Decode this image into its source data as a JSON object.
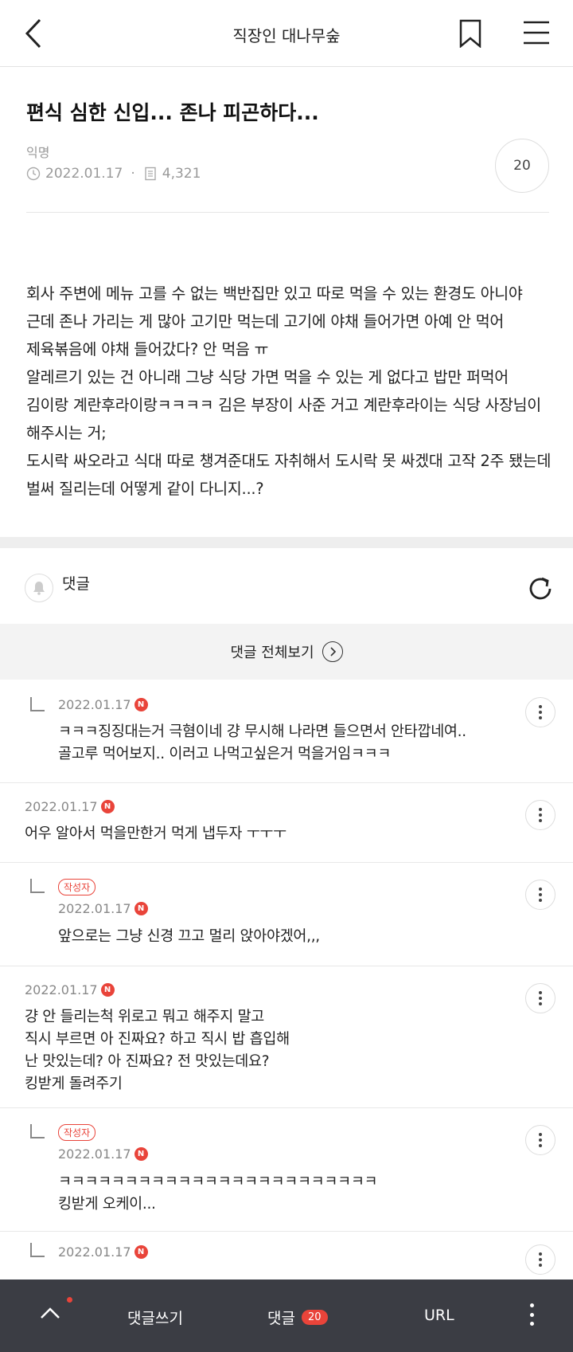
{
  "header": {
    "title": "직장인 대나무숲",
    "back_icon": "chevron-left-icon",
    "bookmark_icon": "bookmark-icon",
    "menu_icon": "hamburger-menu-icon"
  },
  "post": {
    "title": "편식 심한 신입... 존나 피곤하다...",
    "author": "익명",
    "date": "2022.01.17",
    "separator": "·",
    "views": "4,321",
    "comment_count": "20",
    "body": "회사 주변에 메뉴 고를 수 없는 백반집만 있고 따로 먹을 수 있는 환경도 아니야 근데 존나 가리는 게 많아 고기만 먹는데 고기에 야채 들어가면 아예 안 먹어 제육볶음에 야채 들어갔다? 안 먹음 ㅠ\n알레르기 있는 건 아니래 그냥 식당 가면 먹을 수 있는 게 없다고 밥만 퍼먹어 김이랑 계란후라이랑ㅋㅋㅋㅋ 김은 부장이 사준 거고 계란후라이는 식당 사장님이 해주시는 거;\n도시락 싸오라고 식대 따로 챙겨준대도 자취해서 도시락 못 싸겠대 고작 2주 됐는데 벌써 질리는데 어떻게 같이 다니지...?"
  },
  "comments_section": {
    "label": "댓글",
    "view_all": "댓글 전체보기"
  },
  "comments": [
    {
      "reply": true,
      "writer": false,
      "badge": "",
      "date": "2022.01.17",
      "n": "N",
      "text": "ㅋㅋㅋ징징대는거 극혐이네 걍 무시해 나라면 들으면서 안타깝네여.. 골고루 먹어보지.. 이러고 나먹고싶은거 먹을거임ㅋㅋㅋ"
    },
    {
      "reply": false,
      "writer": false,
      "badge": "",
      "date": "2022.01.17",
      "n": "N",
      "text": "어우 알아서 먹을만한거 먹게 냅두자 ㅜㅜㅜ"
    },
    {
      "reply": true,
      "writer": true,
      "badge": "작성자",
      "date": "2022.01.17",
      "n": "N",
      "text": "앞으로는 그냥 신경 끄고 멀리 앉아야겠어,,,"
    },
    {
      "reply": false,
      "writer": false,
      "badge": "",
      "date": "2022.01.17",
      "n": "N",
      "text": "걍 안 들리는척 위로고 뭐고 해주지 말고\n직시 부르면 아 진짜요? 하고 직시 밥 흡입해\n난 맛있는데? 아 진짜요? 전 맛있는데요?\n킹받게 돌려주기"
    },
    {
      "reply": true,
      "writer": true,
      "badge": "작성자",
      "date": "2022.01.17",
      "n": "N",
      "text": "ㅋㅋㅋㅋㅋㅋㅋㅋㅋㅋㅋㅋㅋㅋㅋㅋㅋㅋㅋㅋㅋㅋㅋㅋ\n킹받게 오케이..."
    },
    {
      "reply": true,
      "writer": false,
      "badge": "",
      "date": "2022.01.17",
      "n": "N",
      "text": ""
    }
  ],
  "bottom_bar": {
    "write": "댓글쓰기",
    "comments": "댓글",
    "count": "20",
    "url": "URL"
  },
  "colors": {
    "accent": "#e9443a",
    "bottom_bar": "#3b3d44"
  }
}
